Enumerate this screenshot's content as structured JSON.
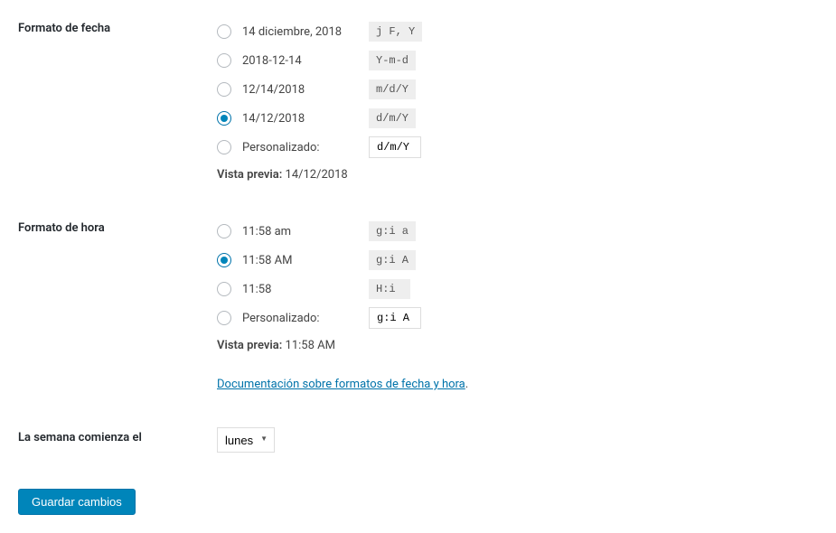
{
  "dateFormat": {
    "label": "Formato de fecha",
    "options": [
      {
        "display": "14 diciembre, 2018",
        "code": "j F, Y",
        "checked": false
      },
      {
        "display": "2018-12-14",
        "code": "Y-m-d",
        "checked": false
      },
      {
        "display": "12/14/2018",
        "code": "m/d/Y",
        "checked": false
      },
      {
        "display": "14/12/2018",
        "code": "d/m/Y",
        "checked": true
      }
    ],
    "customLabel": "Personalizado:",
    "customValue": "d/m/Y",
    "previewLabel": "Vista previa:",
    "previewValue": "14/12/2018"
  },
  "timeFormat": {
    "label": "Formato de hora",
    "options": [
      {
        "display": "11:58 am",
        "code": "g:i a",
        "checked": false
      },
      {
        "display": "11:58 AM",
        "code": "g:i A",
        "checked": true
      },
      {
        "display": "11:58",
        "code": "H:i",
        "checked": false
      }
    ],
    "customLabel": "Personalizado:",
    "customValue": "g:i A",
    "previewLabel": "Vista previa:",
    "previewValue": "11:58 AM"
  },
  "docLink": "Documentación sobre formatos de fecha y hora",
  "weekStart": {
    "label": "La semana comienza el",
    "value": "lunes"
  },
  "saveButton": "Guardar cambios"
}
